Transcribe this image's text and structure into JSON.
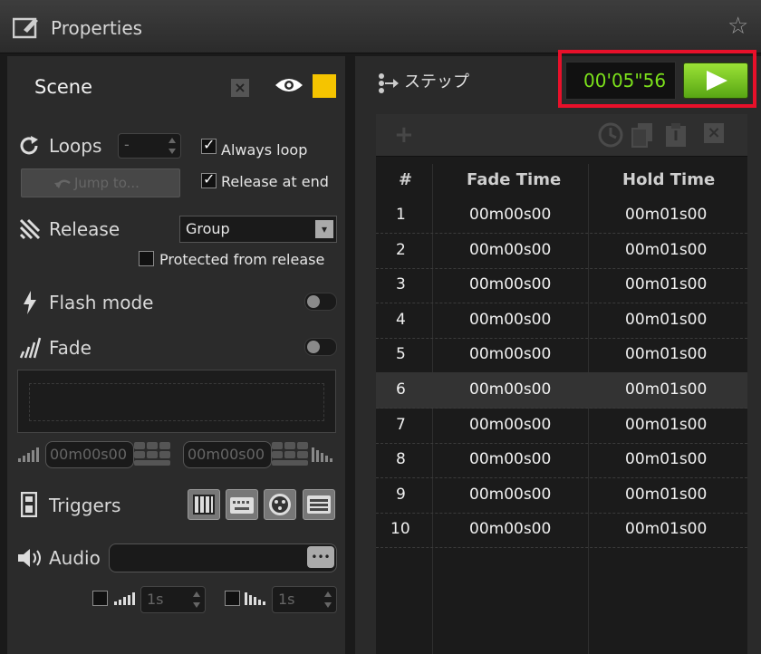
{
  "window": {
    "title": "Properties"
  },
  "scene": {
    "name": "Scene",
    "color": "#f5c400"
  },
  "loops": {
    "label": "Loops",
    "value": "-",
    "always_loop": {
      "label": "Always loop",
      "checked": true
    },
    "jump_to_label": "Jump to...",
    "release_at_end": {
      "label": "Release at end",
      "checked": true
    }
  },
  "release": {
    "label": "Release",
    "selected": "Group",
    "protected": {
      "label": "Protected from release",
      "checked": false
    }
  },
  "flash_mode": {
    "label": "Flash mode"
  },
  "fade": {
    "label": "Fade",
    "fade_in_time": "00m00s00",
    "fade_out_time": "00m00s00"
  },
  "triggers": {
    "label": "Triggers"
  },
  "audio": {
    "label": "Audio",
    "file": "",
    "browse_label": "•••",
    "fade_in": {
      "checked": false,
      "value": "1s"
    },
    "fade_out": {
      "checked": false,
      "value": "1s"
    }
  },
  "step": {
    "label": "ステップ",
    "time": "00'05\"56"
  },
  "steps_table": {
    "columns": [
      "#",
      "Fade Time",
      "Hold Time"
    ],
    "selected_index": 6,
    "rows": [
      {
        "n": "1",
        "fade": "00m00s00",
        "hold": "00m01s00"
      },
      {
        "n": "2",
        "fade": "00m00s00",
        "hold": "00m01s00"
      },
      {
        "n": "3",
        "fade": "00m00s00",
        "hold": "00m01s00"
      },
      {
        "n": "4",
        "fade": "00m00s00",
        "hold": "00m01s00"
      },
      {
        "n": "5",
        "fade": "00m00s00",
        "hold": "00m01s00"
      },
      {
        "n": "6",
        "fade": "00m00s00",
        "hold": "00m01s00"
      },
      {
        "n": "7",
        "fade": "00m00s00",
        "hold": "00m01s00"
      },
      {
        "n": "8",
        "fade": "00m00s00",
        "hold": "00m01s00"
      },
      {
        "n": "9",
        "fade": "00m00s00",
        "hold": "00m01s00"
      },
      {
        "n": "10",
        "fade": "00m00s00",
        "hold": "00m01s00"
      }
    ]
  },
  "icons": [
    "app-icon",
    "star-icon",
    "close-icon",
    "eye-icon",
    "loop-icon",
    "release-icon",
    "flash-icon",
    "fade-icon",
    "triggers-icon",
    "audio-icon",
    "step-icon",
    "play-icon",
    "add-icon",
    "clock-icon",
    "copy-icon",
    "paste-icon",
    "delete-icon"
  ]
}
